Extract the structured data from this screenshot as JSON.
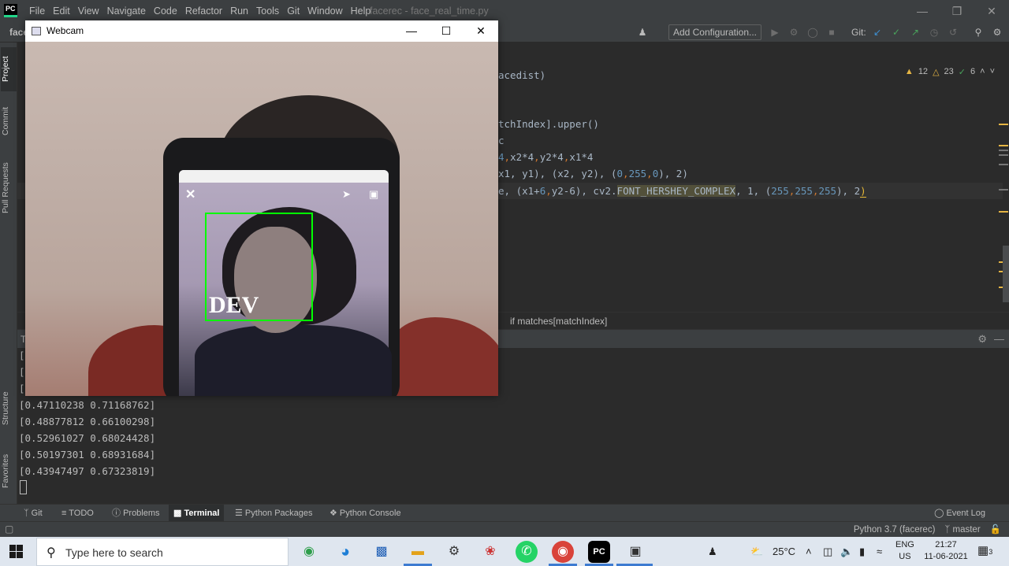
{
  "ide": {
    "logo": "PC",
    "menu": [
      "File",
      "Edit",
      "View",
      "Navigate",
      "Code",
      "Refactor",
      "Run",
      "Tools",
      "Git",
      "Window",
      "Help"
    ],
    "file_title": "facerec - face_real_time.py",
    "project_crumb": "face",
    "add_configuration": "Add Configuration...",
    "git_label": "Git:",
    "inspections": {
      "warnings": "12",
      "weak_warnings": "23",
      "ok": "6"
    }
  },
  "left_strip": [
    "Project",
    "Commit",
    "Pull Requests",
    "Structure",
    "Favorites"
  ],
  "editor": {
    "lines": [
      "acedist)",
      "tchIndex].upper()",
      "c"
    ],
    "line4_prefix": "4",
    "line4_rest": "x2*4",
    "line4_y2": "y2*4",
    "line4_x1": "x1*4",
    "line5": "x1, y1), (x2, y2), (",
    "line5_nums": [
      "0",
      "255",
      "0"
    ],
    "line5_end": "), 2)",
    "line6_start": "e, (x1+",
    "line6_6": "6",
    "line6_mid": "y2-6), cv2.",
    "line6_fn": "FONT_HERSHEY_COMPLEX",
    "line6_after": ", 1, (",
    "line6_nums": [
      "255",
      "255",
      "255"
    ],
    "line6_end": "), 2",
    "line6_paren": ")",
    "breadcrumb": "if matches[matchIndex]"
  },
  "terminal": {
    "title": "T",
    "partial_lines": [
      "[",
      "[",
      "["
    ],
    "lines": [
      "[0.47110238 0.71168762]",
      "[0.48877812 0.66100298]",
      "[0.52961027 0.68024428]",
      "[0.50197301 0.68931684]",
      "[0.43947497 0.67323819]"
    ]
  },
  "bottom_tabs": [
    {
      "icon": "git-icon",
      "label": "Git"
    },
    {
      "icon": "todo-icon",
      "label": "TODO"
    },
    {
      "icon": "problems-icon",
      "label": "Problems"
    },
    {
      "icon": "terminal-icon",
      "label": "Terminal",
      "active": true
    },
    {
      "icon": "python-packages-icon",
      "label": "Python Packages"
    },
    {
      "icon": "python-console-icon",
      "label": "Python Console"
    }
  ],
  "event_log": "Event Log",
  "status": {
    "interpreter": "Python 3.7 (facerec)",
    "branch": "master"
  },
  "webcam": {
    "title": "Webcam",
    "label": "DEV",
    "box_color": "#00ff00"
  },
  "taskbar": {
    "search_placeholder": "Type here to search",
    "weather": "25°C",
    "lang_top": "ENG",
    "lang_bottom": "US",
    "time": "21:27",
    "date": "11-06-2021",
    "notification_count": "3"
  },
  "colors": {
    "ide_bg": "#2b2b2b",
    "ide_panel": "#3c3f41",
    "number": "#6897bb",
    "warning": "#e5b544",
    "taskbar": "#dfe6ef"
  }
}
